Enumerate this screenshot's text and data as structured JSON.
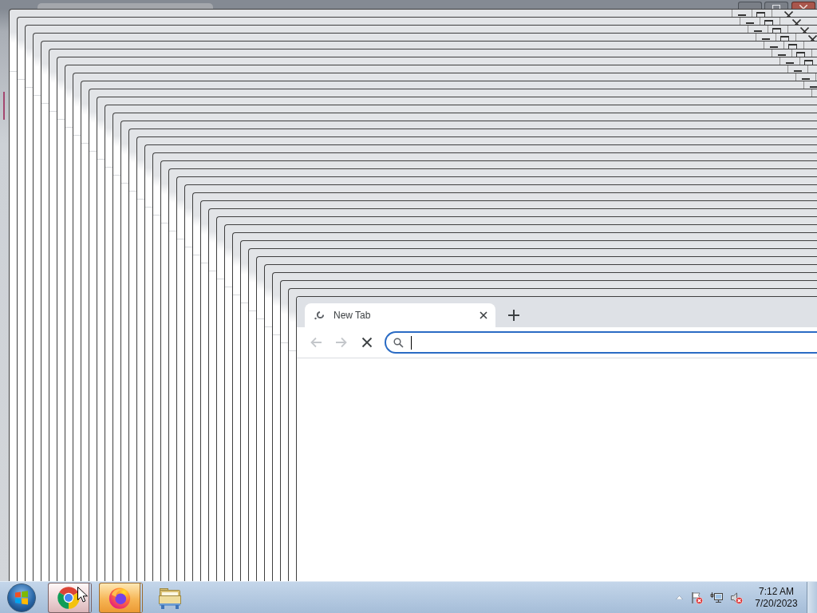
{
  "cascade_windows": [
    {
      "kind": "chrome"
    },
    {
      "kind": "chrome"
    },
    {
      "kind": "chrome"
    },
    {
      "kind": "chrome"
    },
    {
      "kind": "chrome"
    },
    {
      "kind": "chrome"
    },
    {
      "kind": "chrome"
    },
    {
      "kind": "chrome"
    },
    {
      "kind": "chrome"
    },
    {
      "kind": "chrome"
    },
    {
      "kind": "chrome"
    },
    {
      "kind": "chrome"
    },
    {
      "kind": "chrome"
    },
    {
      "kind": "chrome"
    },
    {
      "kind": "chrome"
    },
    {
      "kind": "chrome"
    },
    {
      "kind": "chrome"
    },
    {
      "kind": "chrome"
    },
    {
      "kind": "chrome"
    },
    {
      "kind": "chrome"
    },
    {
      "kind": "chrome"
    },
    {
      "kind": "chrome"
    },
    {
      "kind": "chrome"
    },
    {
      "kind": "chrome"
    },
    {
      "kind": "chrome"
    },
    {
      "kind": "chrome"
    },
    {
      "kind": "chrome"
    },
    {
      "kind": "chrome"
    },
    {
      "kind": "chrome"
    },
    {
      "kind": "chrome"
    },
    {
      "kind": "chrome"
    },
    {
      "kind": "chrome"
    },
    {
      "kind": "chrome"
    },
    {
      "kind": "chrome"
    },
    {
      "kind": "chrome"
    },
    {
      "kind": "chrome"
    }
  ],
  "browser": {
    "tabs": [
      {
        "title": "New Tab",
        "selected": true,
        "loading": true
      }
    ],
    "back": {
      "disabled": true
    },
    "forward": {
      "disabled": true
    },
    "loading": true,
    "omnibox": {
      "focused": true
    }
  },
  "taskbar": {
    "buttons": [
      {
        "kind": "chrome",
        "hovered": true,
        "flashing": false,
        "stacked": true
      },
      {
        "kind": "firefox",
        "hovered": false,
        "flashing": true,
        "stacked": true
      },
      {
        "kind": "explorer",
        "hovered": false,
        "flashing": false,
        "stacked": false
      }
    ],
    "tray": [
      {
        "kind": "show_hidden"
      },
      {
        "kind": "action_center",
        "alert": true
      },
      {
        "kind": "network",
        "alert": false
      },
      {
        "kind": "volume",
        "alert": true
      }
    ],
    "clock": {
      "time": "7:12 AM",
      "date": "7/20/2023"
    }
  }
}
